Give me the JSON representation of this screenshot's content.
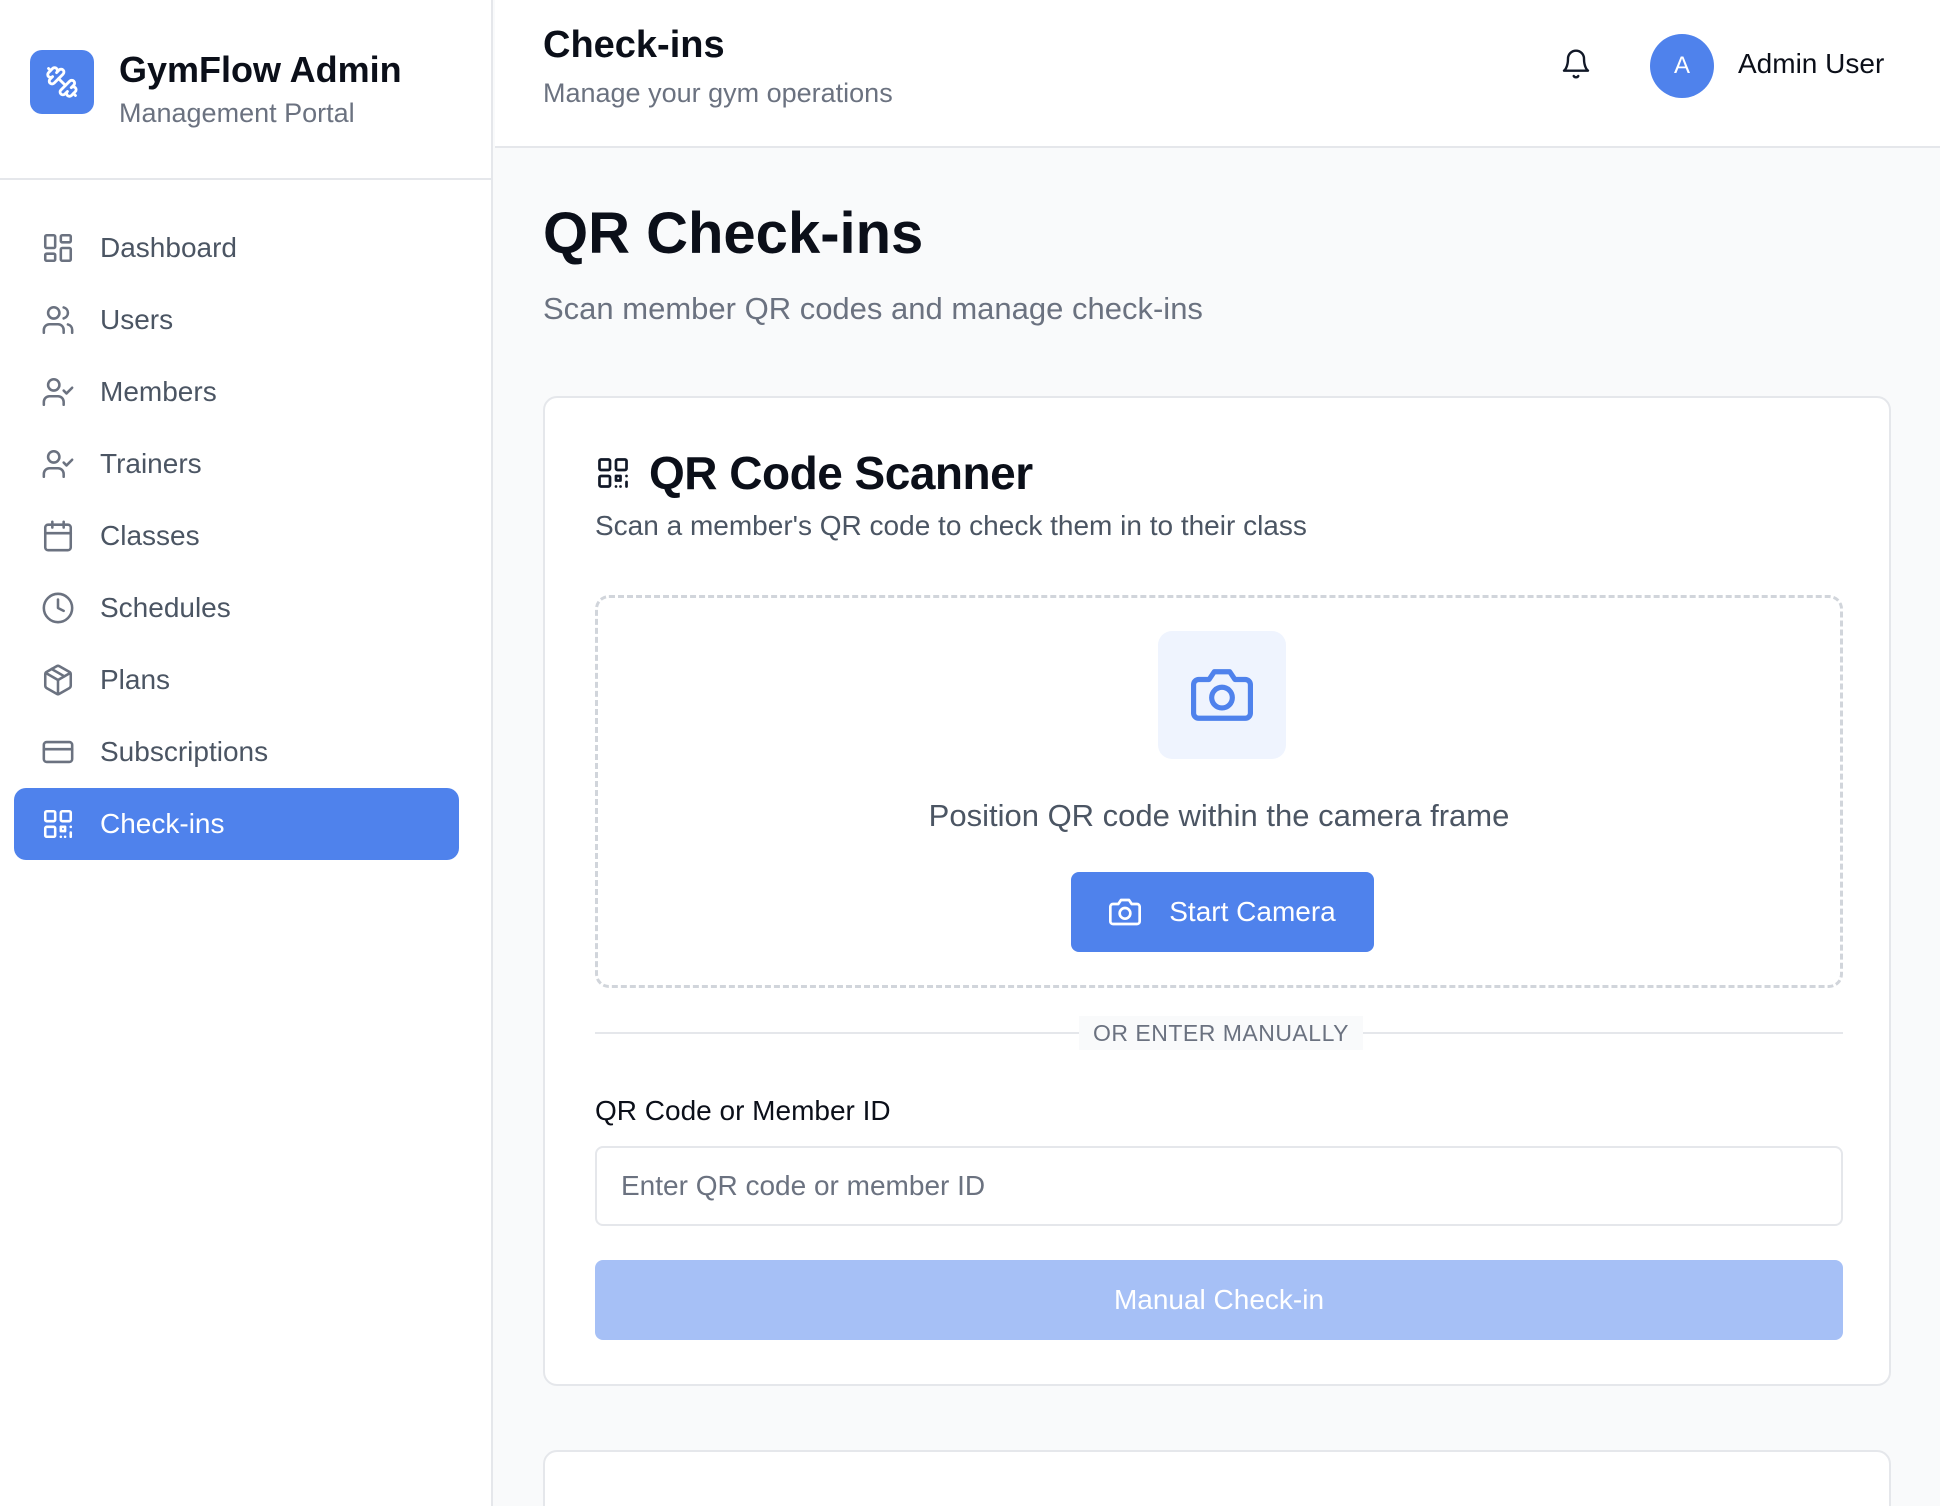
{
  "brand": {
    "title": "GymFlow Admin",
    "subtitle": "Management Portal",
    "logo_icon": "dumbbell-icon"
  },
  "sidebar": {
    "items": [
      {
        "label": "Dashboard",
        "icon": "layout-grid-icon",
        "active": false
      },
      {
        "label": "Users",
        "icon": "users-icon",
        "active": false
      },
      {
        "label": "Members",
        "icon": "user-check-icon",
        "active": false
      },
      {
        "label": "Trainers",
        "icon": "user-check-icon",
        "active": false
      },
      {
        "label": "Classes",
        "icon": "calendar-icon",
        "active": false
      },
      {
        "label": "Schedules",
        "icon": "clock-icon",
        "active": false
      },
      {
        "label": "Plans",
        "icon": "package-icon",
        "active": false
      },
      {
        "label": "Subscriptions",
        "icon": "credit-card-icon",
        "active": false
      },
      {
        "label": "Check-ins",
        "icon": "qr-code-icon",
        "active": true
      }
    ]
  },
  "header": {
    "title": "Check-ins",
    "subtitle": "Manage your gym operations",
    "avatar_initial": "A",
    "user_name": "Admin User"
  },
  "main": {
    "title": "QR Check-ins",
    "subtitle": "Scan member QR codes and manage check-ins"
  },
  "scanner": {
    "title": "QR Code Scanner",
    "subtitle": "Scan a member's QR code to check them in to their class",
    "hint": "Position QR code within the camera frame",
    "start_button": "Start Camera",
    "divider_text": "OR ENTER MANUALLY",
    "field_label": "QR Code or Member ID",
    "field_placeholder": "Enter QR code or member ID",
    "field_value": "",
    "manual_button": "Manual Check-in"
  },
  "colors": {
    "accent": "#4f82ec",
    "accent_disabled": "#a6c0f6",
    "accent_soft": "#eff4fe"
  }
}
